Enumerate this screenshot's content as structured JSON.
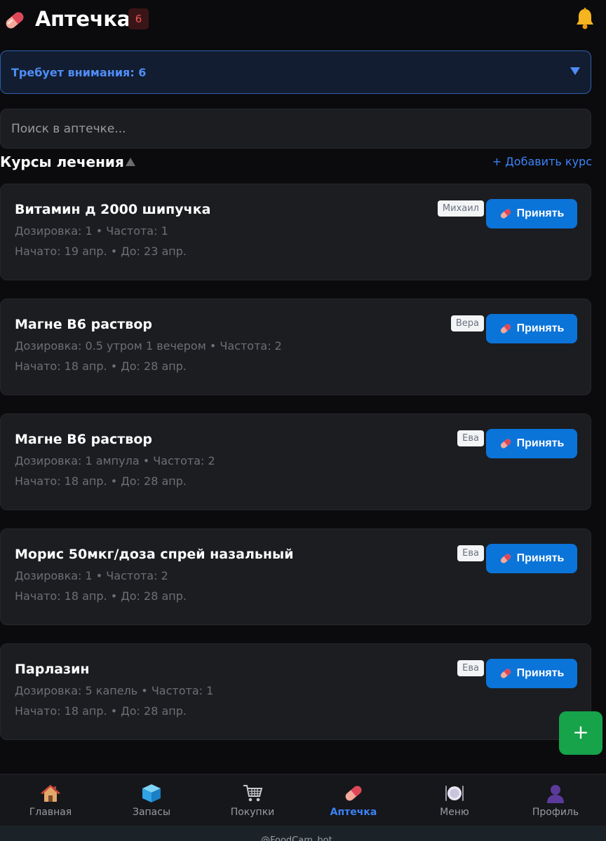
{
  "header": {
    "title": "Аптечка",
    "badge": "6",
    "pill_icon": "pill-icon",
    "bell_icon": "bell-icon"
  },
  "attention": {
    "label": "Требует внимания: 6",
    "arrow_icon": "triangle-down-icon"
  },
  "search": {
    "placeholder": "Поиск в аптечке..."
  },
  "section": {
    "title": "Курсы лечения",
    "toggle_icon": "triangle-up-icon",
    "add_label": "+ Добавить курс"
  },
  "courses": [
    {
      "name": "Витамин д 2000 шипучка",
      "details": "Дозировка: 1 • Частота: 1",
      "dates": "Начато: 19 апр. • До: 23 апр.",
      "owner": "Михаил",
      "action": "Принять"
    },
    {
      "name": "Магне В6 раствор",
      "details": "Дозировка: 0.5 утром 1 вечером • Частота: 2",
      "dates": "Начато: 18 апр. • До: 28 апр.",
      "owner": "Вера",
      "action": "Принять"
    },
    {
      "name": "Магне В6 раствор",
      "details": "Дозировка: 1 ампула • Частота: 2",
      "dates": "Начато: 18 апр. • До: 28 апр.",
      "owner": "Ева",
      "action": "Принять"
    },
    {
      "name": "Морис 50мкг/доза спрей назальный",
      "details": "Дозировка: 1 • Частота: 2",
      "dates": "Начато: 18 апр. • До: 28 апр.",
      "owner": "Ева",
      "action": "Принять"
    },
    {
      "name": "Парлазин",
      "details": "Дозировка: 5 капель • Частота: 1",
      "dates": "Начато: 18 апр. • До: 28 апр.",
      "owner": "Ева",
      "action": "Принять"
    }
  ],
  "fab": {
    "label": "+"
  },
  "nav": {
    "items": [
      {
        "label": "Главная",
        "icon": "house-icon"
      },
      {
        "label": "Запасы",
        "icon": "cube-icon"
      },
      {
        "label": "Покупки",
        "icon": "cart-icon"
      },
      {
        "label": "Аптечка",
        "icon": "pill-icon",
        "active": true
      },
      {
        "label": "Меню",
        "icon": "plate-icon"
      },
      {
        "label": "Профиль",
        "icon": "profile-icon"
      }
    ]
  },
  "footer": {
    "text": "@FoodCam_bot"
  },
  "colors": {
    "accent_blue": "#0b74d9",
    "link_blue": "#3b82f6",
    "fab_green": "#16a34a",
    "badge_red": "#f05252"
  }
}
